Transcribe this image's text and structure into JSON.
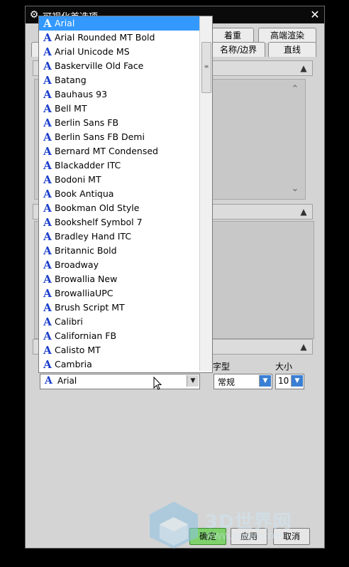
{
  "window": {
    "title": "可视化首选项",
    "close_glyph": "✕"
  },
  "tabs": {
    "row1": [
      "着重",
      "高端渲染"
    ],
    "row2": [
      "名称/边界",
      "直线"
    ]
  },
  "font_dropdown": {
    "selected": "Arial",
    "items": [
      "Arial",
      "Arial Rounded MT Bold",
      "Arial Unicode MS",
      "Baskerville Old Face",
      "Batang",
      "Bauhaus 93",
      "Bell MT",
      "Berlin Sans FB",
      "Berlin Sans FB Demi",
      "Bernard MT Condensed",
      "Blackadder ITC",
      "Bodoni MT",
      "Book Antiqua",
      "Bookman Old Style",
      "Bookshelf Symbol 7",
      "Bradley Hand ITC",
      "Britannic Bold",
      "Broadway",
      "Browallia New",
      "BrowalliaUPC",
      "Brush Script MT",
      "Calibri",
      "Californian FB",
      "Calisto MT",
      "Cambria"
    ],
    "font_icon_glyph": "A"
  },
  "font_settings": {
    "font_value": "Arial",
    "style_label": "字型",
    "style_value": "常规",
    "size_label": "大小",
    "size_value": "10"
  },
  "buttons": {
    "ok": "确定",
    "apply": "应用",
    "cancel": "取消"
  },
  "watermark": {
    "text": "3D世界网",
    "url": "WWW.3DSJW.COM"
  },
  "colors": {
    "selection": "#3399ff",
    "font_icon": "#1a3dcc",
    "ok_button": "#7fd16c"
  }
}
